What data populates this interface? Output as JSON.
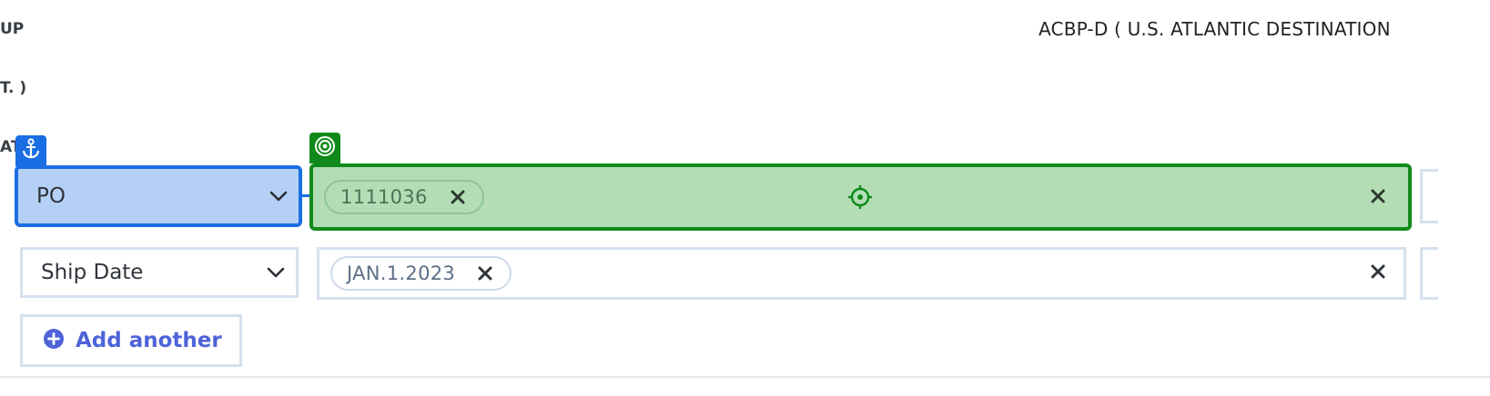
{
  "clipped_labels": {
    "line1": "UP",
    "line2": "T. )",
    "line3": "AT"
  },
  "header": {
    "destination_title": "ACBP-D ( U.S. ATLANTIC DESTINATION"
  },
  "filters": [
    {
      "field_label": "PO",
      "value_chip": "1111036",
      "state": "highlighted"
    },
    {
      "field_label": "Ship Date",
      "value_chip": "JAN.1.2023",
      "state": "normal"
    }
  ],
  "add_another": {
    "label": "Add another"
  },
  "icons": {
    "anchor_badge": "anchor-icon",
    "target_badge": "target-icon",
    "crosshair": "crosshair-icon",
    "chevron": "chevron-down-icon",
    "remove": "close-icon",
    "add": "plus-circle-icon"
  },
  "colors": {
    "anchor_blue": "#1a6ee3",
    "anchor_fill": "#b4d1f5",
    "target_green": "#0f8a1a",
    "target_fill": "#b3deb5",
    "link_accent": "#4e63d8",
    "border_gray": "#d6e0ee"
  }
}
